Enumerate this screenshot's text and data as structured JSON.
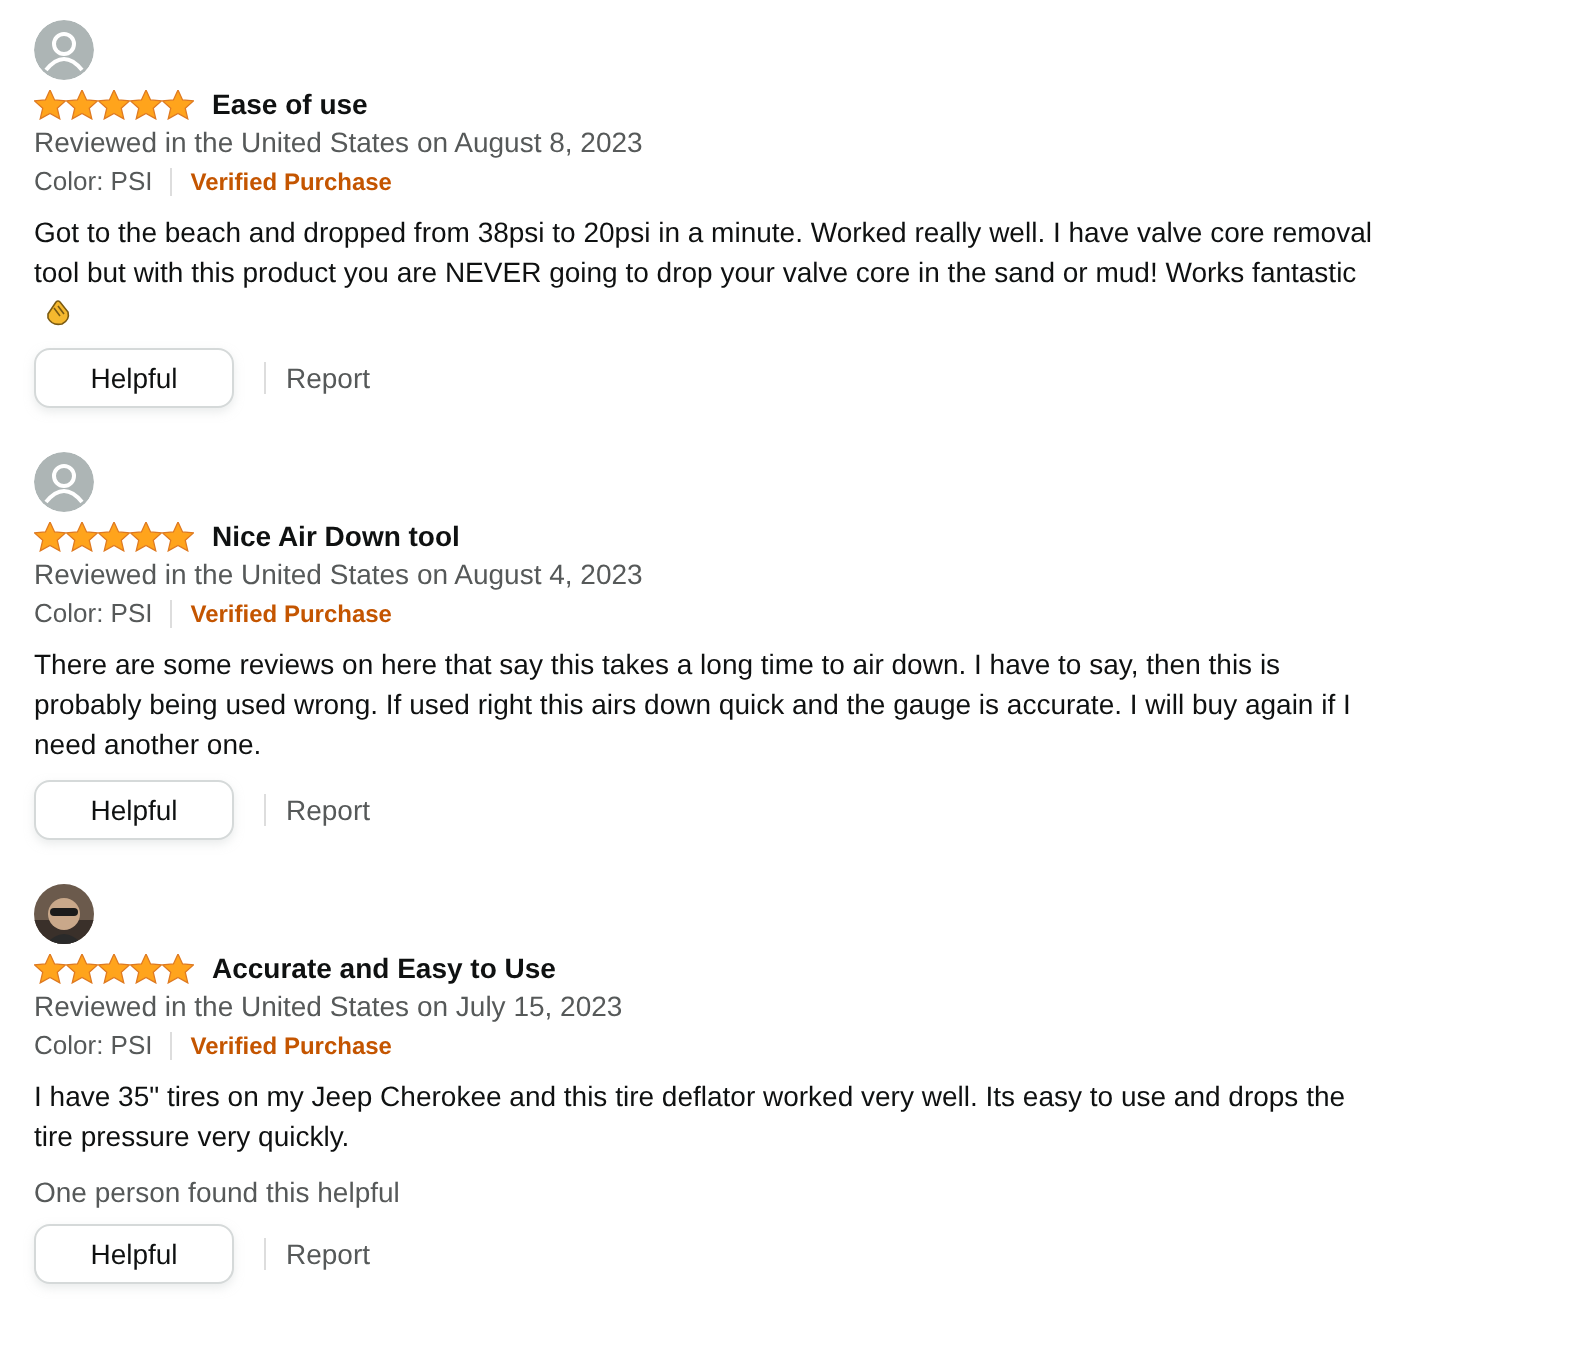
{
  "reviews": [
    {
      "avatar": {
        "kind": "default"
      },
      "stars": 5,
      "title": "Ease of use",
      "meta": "Reviewed in the United States on August 8, 2023",
      "variant": "Color: PSI",
      "badge": "Verified Purchase",
      "body": "Got to the beach and dropped from 38psi to 20psi in a minute. Worked really well. I have valve core removal tool but with this product you are NEVER going to drop your valve core in the sand or mud! Works fantastic",
      "emoji": true,
      "buttons": {
        "helpful": "Helpful",
        "report": "Report"
      }
    },
    {
      "avatar": {
        "kind": "default"
      },
      "stars": 5,
      "title": "Nice Air Down tool",
      "meta": "Reviewed in the United States on August 4, 2023",
      "variant": "Color: PSI",
      "badge": "Verified Purchase",
      "body": "There are some reviews on here that say this takes a long time to air down. I have to say, then this is probably being used wrong. If used right this airs down quick and the gauge is accurate. I will buy again if I need another one.",
      "emoji": false,
      "buttons": {
        "helpful": "Helpful",
        "report": "Report"
      }
    },
    {
      "stars": 5,
      "title": "Accurate and Easy to Use",
      "meta": "Reviewed in the United States on July 15, 2023",
      "variant": "Color: PSI",
      "badge": "Verified Purchase",
      "body": "I have 35\" tires on my Jeep Cherokee and this tire deflator worked very well. Its easy to use and drops the tire pressure very quickly.",
      "emoji": false,
      "helpful_count": "One person found this helpful",
      "buttons": {
        "helpful": "Helpful",
        "report": "Report"
      }
    }
  ]
}
